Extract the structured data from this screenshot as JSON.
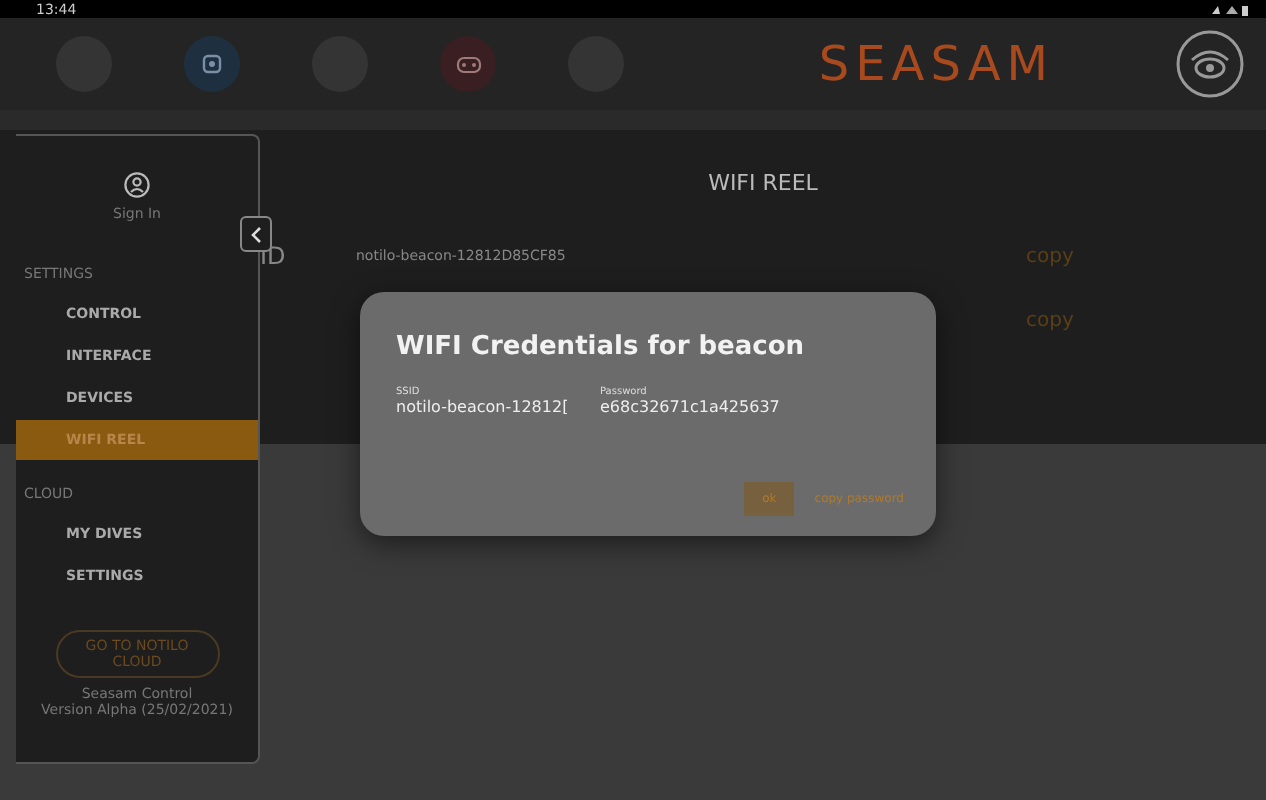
{
  "status_bar": {
    "time": "13:44"
  },
  "header": {
    "logo": "SEASAM",
    "nav_buttons": [
      {
        "kind": "blank"
      },
      {
        "kind": "drone"
      },
      {
        "kind": "blank"
      },
      {
        "kind": "gamepad"
      },
      {
        "kind": "blank"
      }
    ]
  },
  "main": {
    "title": "WIFI REEL",
    "rows": [
      {
        "label": "ID",
        "value": "notilo-beacon-12812D85CF85",
        "action": "copy"
      },
      {
        "label": "",
        "value": "",
        "action": "copy"
      }
    ]
  },
  "sidebar": {
    "sign_in": "Sign In",
    "sections": [
      {
        "heading": "SETTINGS",
        "items": [
          {
            "label": "CONTROL",
            "selected": false
          },
          {
            "label": "INTERFACE",
            "selected": false
          },
          {
            "label": "DEVICES",
            "selected": false
          },
          {
            "label": "WIFI REEL",
            "selected": true
          }
        ]
      },
      {
        "heading": "CLOUD",
        "items": [
          {
            "label": "MY DIVES",
            "selected": false
          },
          {
            "label": "SETTINGS",
            "selected": false
          }
        ]
      }
    ],
    "cloud_button": "GO TO NOTILO CLOUD",
    "version": [
      "Seasam Control",
      "Version Alpha (25/02/2021)"
    ]
  },
  "dialog": {
    "title": "WIFI Credentials for beacon",
    "fields": [
      {
        "label": "SSID",
        "value": "notilo-beacon-12812["
      },
      {
        "label": "Password",
        "value": "e68c32671c1a425637"
      }
    ],
    "buttons": [
      "ok",
      "copy password"
    ]
  }
}
